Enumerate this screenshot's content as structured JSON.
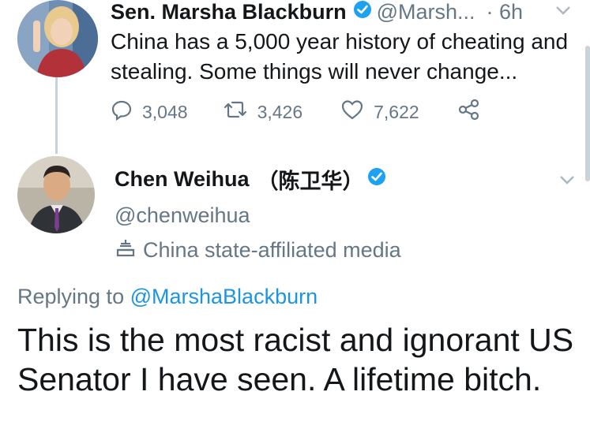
{
  "tweet1": {
    "author_name": "Sen. Marsha Blackburn",
    "handle": "@Marsh...",
    "time": "· 6h",
    "text": "China has a 5,000 year history of cheating and stealing. Some things will never change...",
    "replies": "3,048",
    "retweets": "3,426",
    "likes": "7,622"
  },
  "tweet2": {
    "author_name": "Chen Weihua",
    "author_name_cjk": "（陈卫华）",
    "handle": "@chenweihua",
    "label": "China state-affiliated media",
    "replying_prefix": "Replying to",
    "replying_to": "@MarshaBlackburn",
    "text": "This is the most racist and ignorant US Senator I have seen.  A lifetime bitch."
  },
  "colors": {
    "verified": "#1da1f2",
    "link": "#1b95e0",
    "muted": "#657786",
    "thread_line": "#c6d2da"
  },
  "icons": [
    "verified-badge-icon",
    "chevron-down-icon",
    "reply-icon",
    "retweet-icon",
    "like-icon",
    "share-icon",
    "state-media-icon"
  ]
}
